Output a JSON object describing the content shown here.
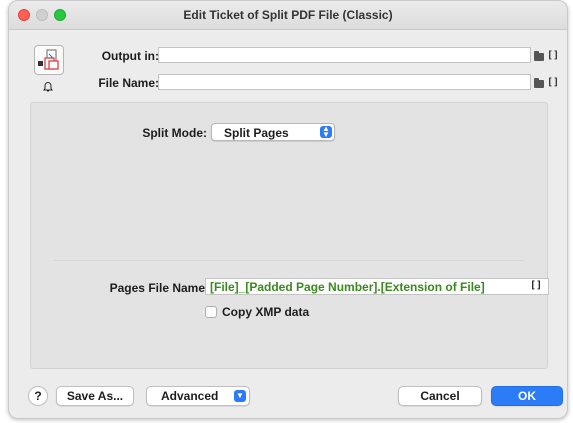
{
  "window": {
    "title": "Edit Ticket of Split PDF File (Classic)"
  },
  "fields": {
    "output_in_label": "Output in:",
    "output_in_value": "",
    "file_name_label": "File Name:",
    "file_name_value": "",
    "bracket_glyph": "[]"
  },
  "split": {
    "mode_label": "Split Mode:",
    "mode_value": "Split Pages",
    "pages_file_name_label": "Pages File Name:",
    "pages_file_name_value": "[File]_[Padded Page Number].[Extension of File]",
    "copy_xmp_label": "Copy XMP data",
    "copy_xmp_checked": false
  },
  "buttons": {
    "help": "?",
    "save_as": "Save As...",
    "advanced": "Advanced",
    "cancel": "Cancel",
    "ok": "OK"
  },
  "colors": {
    "accent": "#2b7cf6",
    "variable_text": "#3a8a1e"
  }
}
